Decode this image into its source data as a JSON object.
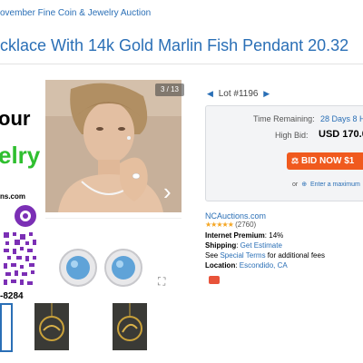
{
  "breadcrumb": "ovember Fine Coin & Jewelry Auction",
  "title": "cklace With 14k Gold Marlin Fish Pendant 20.32",
  "promo": {
    "line1": "our",
    "line2": "elry",
    "line3": "ns.com",
    "line4": "-8284"
  },
  "gallery": {
    "counter": "3 / 13",
    "next_glyph": "›",
    "expand_glyph": "⛶"
  },
  "lot": {
    "label": "Lot #1196"
  },
  "bidbox": {
    "time_label": "Time Remaining:",
    "time_value": "28 Days 8 H",
    "highbid_label": "High Bid:",
    "highbid_value": "USD 170.0",
    "bid_button": "BID NOW $1",
    "or_text": "or",
    "max_link": "Enter a maximum"
  },
  "seller": {
    "name": "NCAuctions.com",
    "stars": "★★★★★",
    "rating_count": "(2760)",
    "premium_label": "Internet Premium",
    "premium_value": ": 14%",
    "shipping_label": "Shipping",
    "shipping_sep": ": ",
    "shipping_link": "Get Estimate",
    "terms_pre": "See ",
    "terms_link": "Special Terms",
    "terms_post": " for additional fees",
    "location_label": "Location",
    "location_sep": ": ",
    "location_value": "Escondido, CA"
  },
  "colors": {
    "link": "#2a6fb6",
    "bid_button": "#f05a1e",
    "promo_green": "#2fbf2f",
    "stars": "#f5a623"
  }
}
